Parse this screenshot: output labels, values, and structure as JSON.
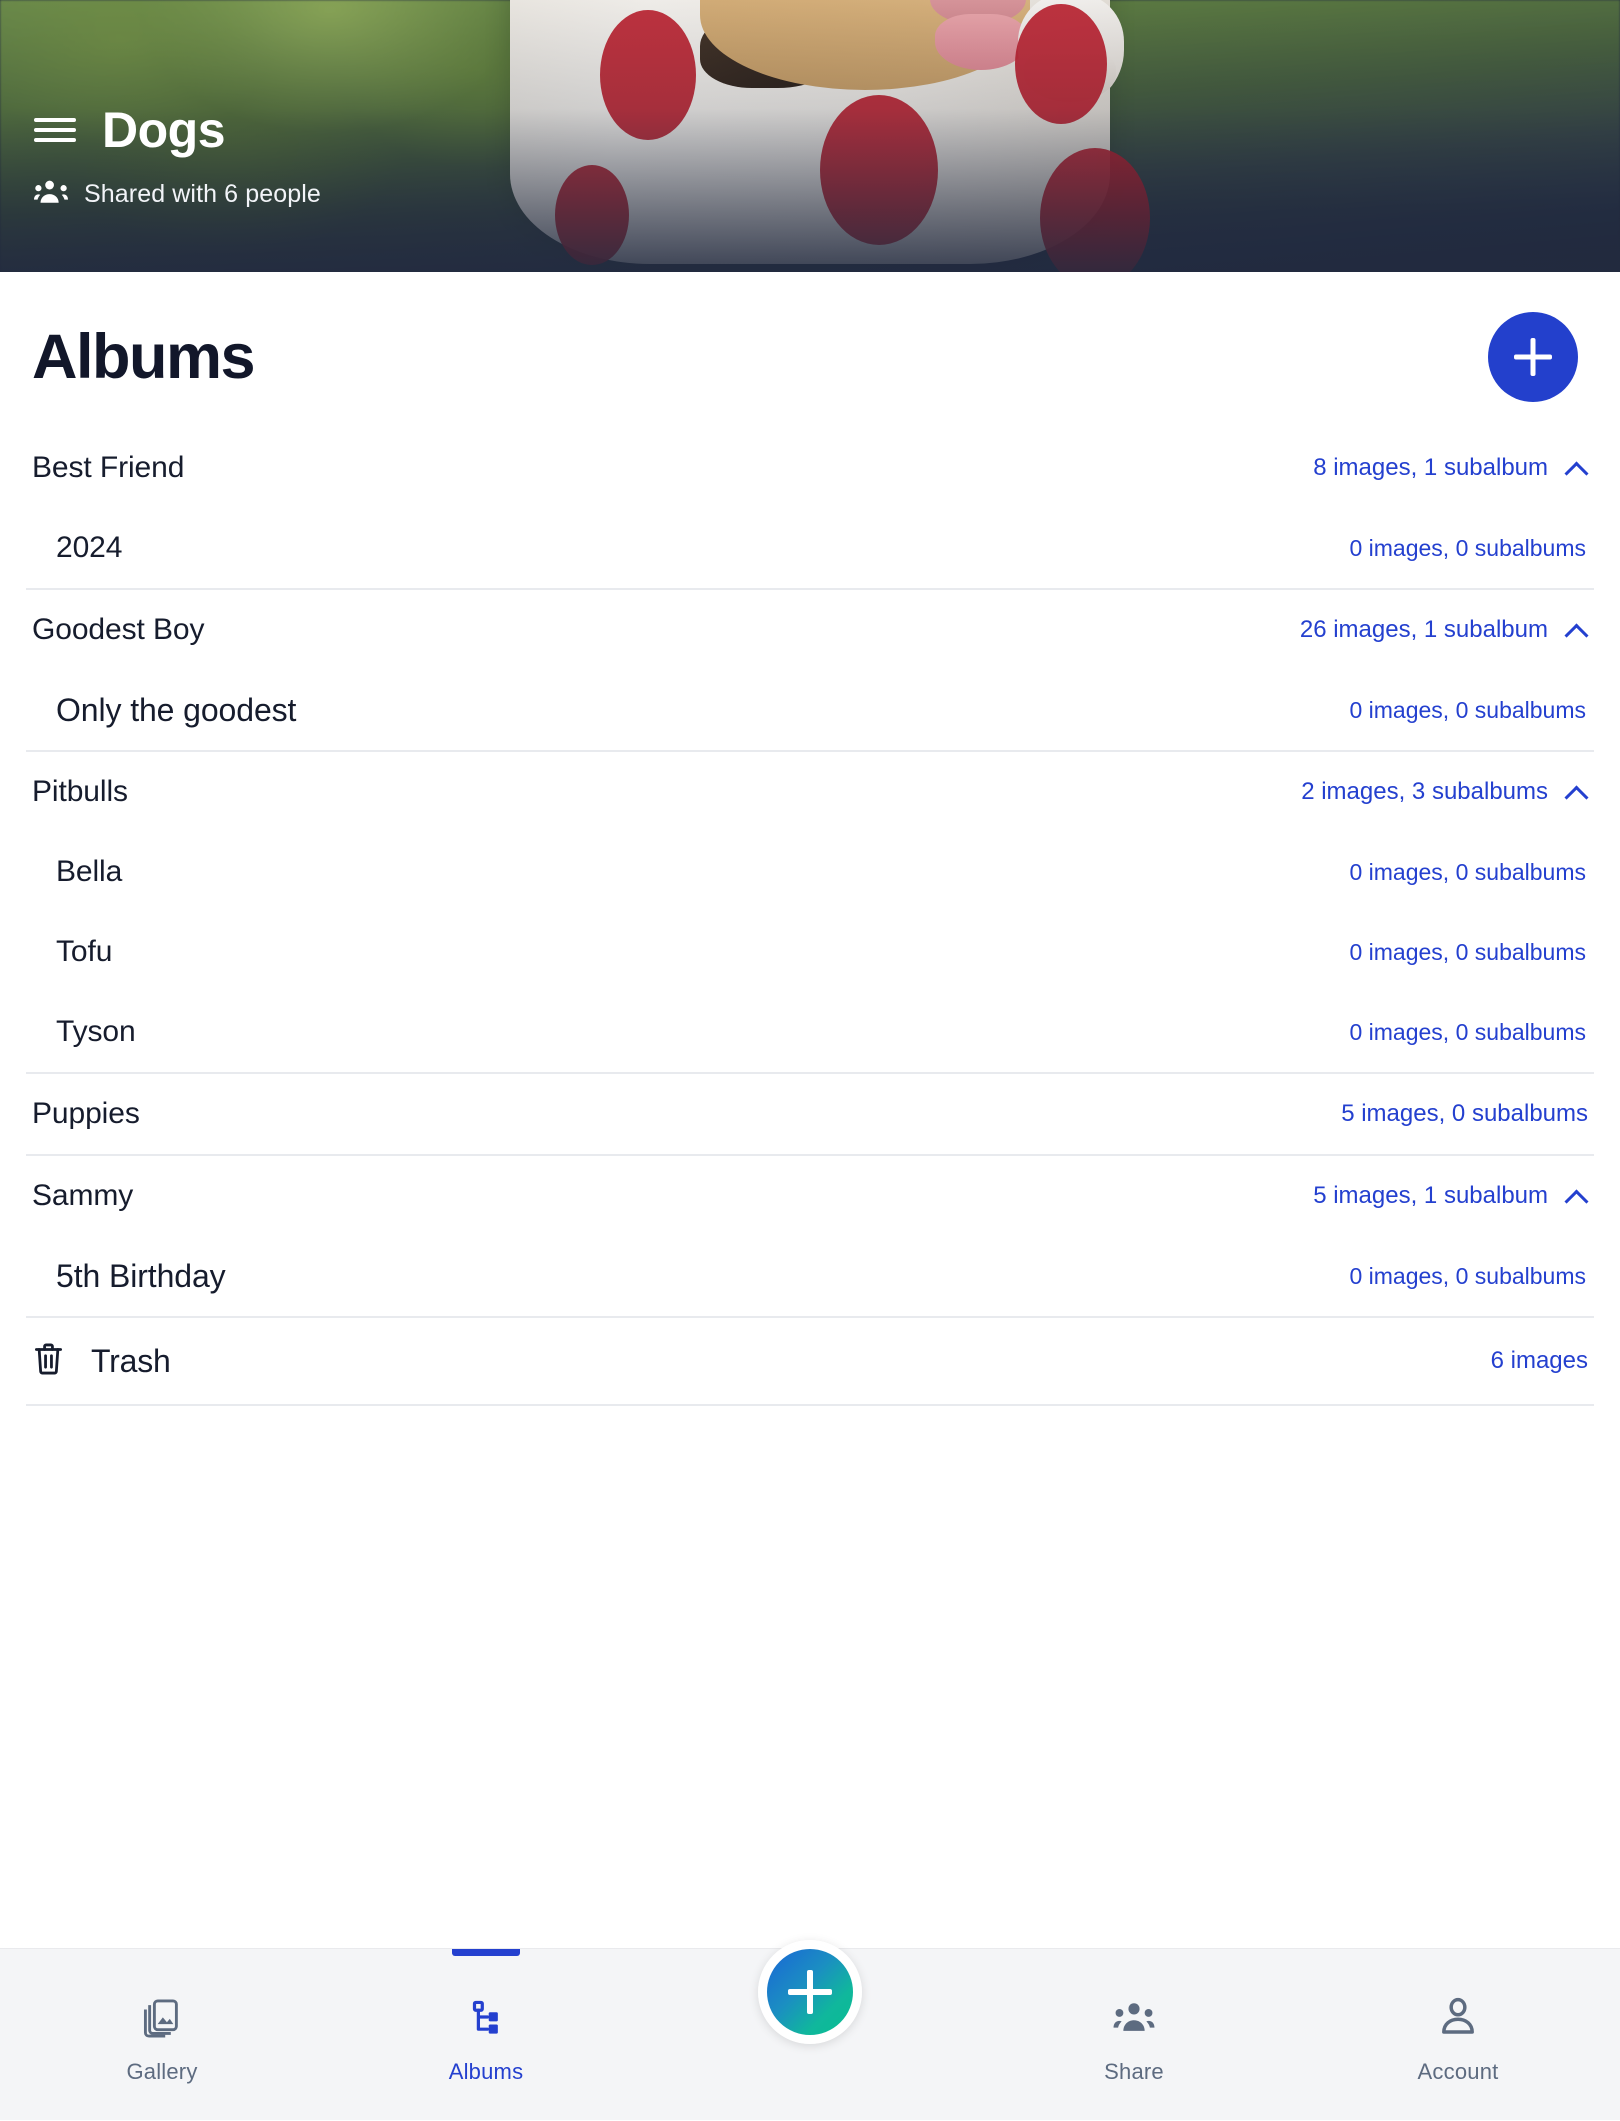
{
  "banner": {
    "menu_icon": "hamburger-menu-icon",
    "title": "Dogs",
    "shared_icon": "people-group-icon",
    "shared_text": "Shared with 6 people"
  },
  "main": {
    "page_title": "Albums",
    "add_button_icon": "plus-icon",
    "albums": [
      {
        "name": "Best Friend",
        "count_text": "8 images, 1 subalbum",
        "expanded": true,
        "chevron_icon": "chevron-up-icon",
        "subalbums": [
          {
            "name": "2024",
            "count_text": "0 images, 0 subalbums"
          }
        ]
      },
      {
        "name": "Goodest Boy",
        "count_text": "26 images, 1 subalbum",
        "expanded": true,
        "chevron_icon": "chevron-up-icon",
        "subalbums": [
          {
            "name": "Only the goodest",
            "count_text": "0 images, 0 subalbums"
          }
        ]
      },
      {
        "name": "Pitbulls",
        "count_text": "2 images, 3 subalbums",
        "expanded": true,
        "chevron_icon": "chevron-up-icon",
        "subalbums": [
          {
            "name": "Bella",
            "count_text": "0 images, 0 subalbums"
          },
          {
            "name": "Tofu",
            "count_text": "0 images, 0 subalbums"
          },
          {
            "name": "Tyson",
            "count_text": "0 images, 0 subalbums"
          }
        ]
      },
      {
        "name": "Puppies",
        "count_text": "5 images, 0 subalbums",
        "expanded": false,
        "chevron_icon": "",
        "subalbums": []
      },
      {
        "name": "Sammy",
        "count_text": "5 images, 1 subalbum",
        "expanded": true,
        "chevron_icon": "chevron-up-icon",
        "subalbums": [
          {
            "name": "5th Birthday",
            "count_text": "0 images, 0 subalbums"
          }
        ]
      }
    ],
    "trash": {
      "icon": "trash-can-icon",
      "label": "Trash",
      "count_text": "6 images"
    }
  },
  "bottom_nav": {
    "items": [
      {
        "label": "Gallery",
        "icon": "gallery-stack-icon",
        "active": false
      },
      {
        "label": "Albums",
        "icon": "albums-tree-icon",
        "active": true
      },
      {
        "label": "Share",
        "icon": "people-group-icon",
        "active": false
      },
      {
        "label": "Account",
        "icon": "person-icon",
        "active": false
      }
    ],
    "fab": {
      "icon": "plus-icon"
    }
  },
  "colors": {
    "accent_blue": "#2440cf",
    "add_button_blue": "#2340cc",
    "fab_gradient_start": "#1a66d6",
    "fab_gradient_end": "#08bd92",
    "text_dark": "#161c2d",
    "nav_inactive": "#5d6b80",
    "nav_background": "#f4f5f7",
    "separator": "#e8eaee"
  }
}
